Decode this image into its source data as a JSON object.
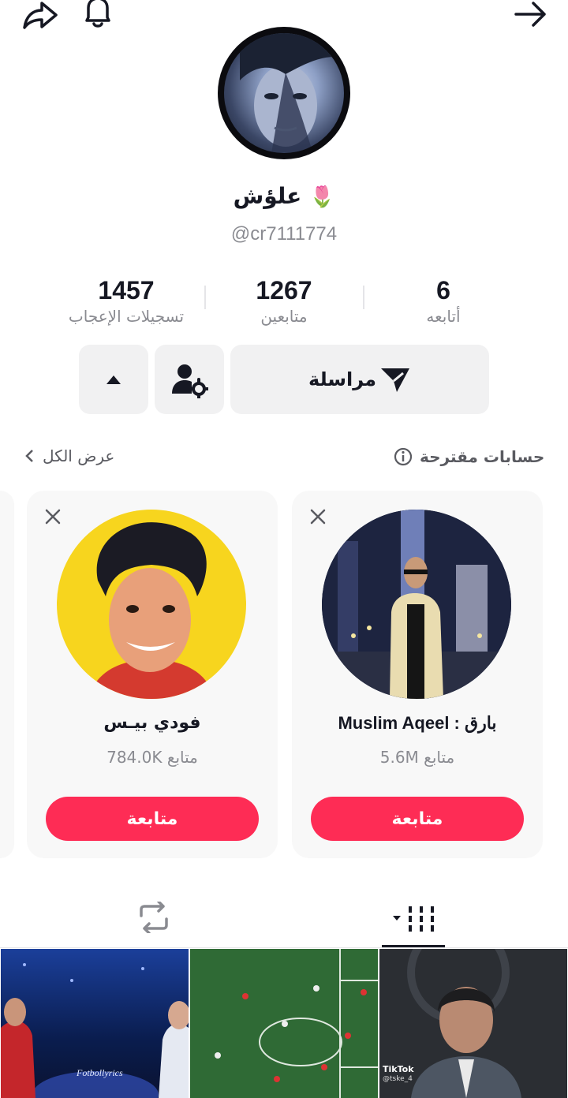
{
  "profile": {
    "display_name": "علؤش",
    "name_emoji": "🌷",
    "username": "@cr7111774"
  },
  "stats": [
    {
      "value": "1457",
      "label": "تسجيلات الإعجاب"
    },
    {
      "value": "1267",
      "label": "متابعين"
    },
    {
      "value": "6",
      "label": "أتابعه"
    }
  ],
  "actions": {
    "message_label": "مراسلة"
  },
  "suggested": {
    "title": "حسابات مقترحة",
    "view_all": "عرض الكل",
    "accounts": [
      {
        "name": "فودي بيـس",
        "followers": "784.0K متابع",
        "follow_label": "متابعة"
      },
      {
        "name": "Muslim Aqeel : بارق",
        "followers": "5.6M متابع",
        "follow_label": "متابعة"
      }
    ]
  },
  "videos": [
    {
      "caption": "Fotbollyrics"
    },
    {
      "caption": ""
    },
    {
      "caption": "TikTok",
      "sub": "@tske_4"
    }
  ],
  "colors": {
    "accent": "#fe2c55",
    "muted": "#8a8b91",
    "surface": "#f1f1f2"
  },
  "icons": [
    "share-icon",
    "bell-icon",
    "back-arrow-icon",
    "send-icon",
    "add-friend-settings-icon",
    "caret-up-icon",
    "info-icon",
    "chevron-left-icon",
    "close-icon",
    "grid-videos-icon",
    "repost-icon"
  ]
}
